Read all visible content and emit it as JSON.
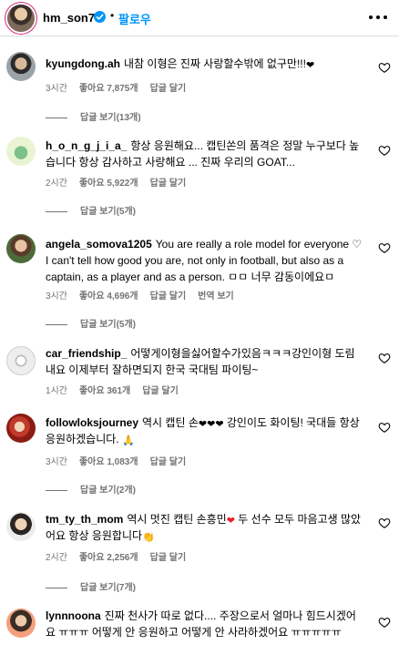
{
  "header": {
    "username": "hm_son7",
    "dot": "•",
    "follow_label": "팔로우"
  },
  "comments": [
    {
      "username": "kyungdong.ah",
      "text": "내참 이형은 진짜 사랑할수밖에 없구만!!!",
      "emoji": "❤",
      "time": "3시간",
      "likes": "좋아요 7,875개",
      "reply": "답글 달기",
      "replies": "답글 보기(13개)"
    },
    {
      "username": "h_o_n_g_j_i_a_",
      "text": "항상 응원해요... 캡틴쏜의 품격은 정말 누구보다 높습니다 항상 감사하고 사랑해요 ... 진짜 우리의 GOAT...",
      "time": "2시간",
      "likes": "좋아요 5,922개",
      "reply": "답글 달기",
      "replies": "답글 보기(5개)"
    },
    {
      "username": "angela_somova1205",
      "text": "You are really a role model for everyone ♡ I can't tell how good you are, not only in football, but also as a captain, as a player and as a person. ㅁㅁ 너무 감동이에요ㅁ",
      "time": "3시간",
      "likes": "좋아요 4,696개",
      "reply": "답글 달기",
      "translate": "번역 보기",
      "replies": "답글 보기(5개)"
    },
    {
      "username": "car_friendship_",
      "text": "어떻게이형을싫어할수가있음ㅋㅋㅋ강인이형 도림내요 이제부터 잘하면되지 한국 국대팀 파이팅~",
      "time": "1시간",
      "likes": "좋아요 361개",
      "reply": "답글 달기"
    },
    {
      "username": "followloksjourney",
      "text": "역시 캡틴 손",
      "emoji": "❤❤❤",
      "text2": "강인이도 화이팅! 국대들 항상 응원하겠습니다.",
      "emoji2": "🙏",
      "time": "3시간",
      "likes": "좋아요 1,083개",
      "reply": "답글 달기",
      "replies": "답글 보기(2개)"
    },
    {
      "username": "tm_ty_th_mom",
      "text": "역시 멋진 캡틴 손흥민",
      "emoji": "❤",
      "text2": "두 선수 모두 마음고생 많았어요 항상 응원합니다",
      "emoji2": "👏",
      "time": "2시간",
      "likes": "좋아요 2,256개",
      "reply": "답글 달기",
      "replies": "답글 보기(7개)"
    },
    {
      "username": "lynnnoona",
      "text": "진짜 천사가 따로 없다.... 주장으로서 얼마나 힘드시겠어요 ㅠㅠㅠ 어떻게 안 응원하고 어떻게 안 사라하겠어요 ㅠㅠㅠㅠㅠ"
    }
  ],
  "colors": {
    "link_blue": "#0095f6",
    "meta_gray": "#737373",
    "heart_red": "#ed1c24"
  }
}
